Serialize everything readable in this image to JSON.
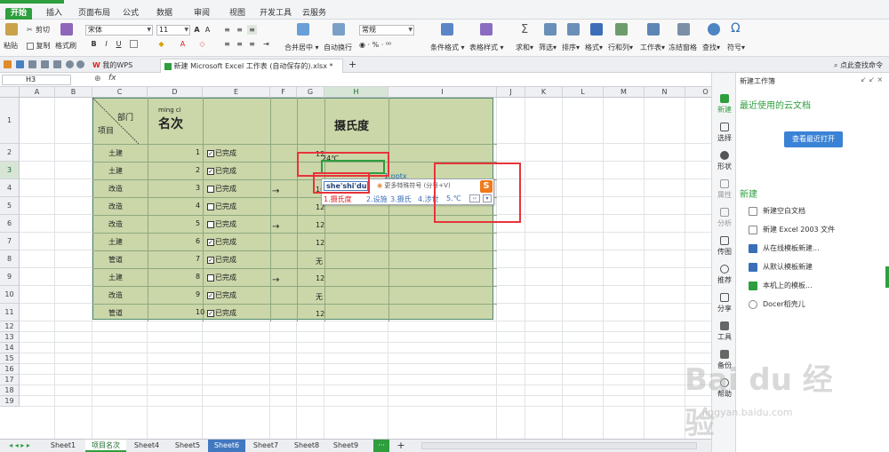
{
  "menu": {
    "tabs": [
      "开始",
      "插入",
      "页面布局",
      "公式",
      "数据",
      "审阅",
      "视图",
      "开发工具",
      "云服务"
    ],
    "active": "开始"
  },
  "ribbon": {
    "paste": "粘贴",
    "cut": "剪切",
    "copy": "复制",
    "format_painter": "格式刷",
    "font_name": "宋体",
    "font_size": "11",
    "merge_center": "合并居中",
    "wrap": "自动换行",
    "number_format": "常规",
    "cond_format": "条件格式",
    "table_style": "表格样式",
    "sum": "求和",
    "filter": "筛选",
    "sort": "排序",
    "format": "格式",
    "rows_cols": "行和列",
    "worksheet": "工作表",
    "freeze": "冻结窗格",
    "find": "查找",
    "symbol": "符号"
  },
  "docbar": {
    "tab1": "我的WPS",
    "tab2": "新建 Microsoft Excel 工作表 (自动保存的).xlsx *",
    "add": "+",
    "right_text": "点此查找命令"
  },
  "formula": {
    "cell_ref": "H3",
    "fx": "fx"
  },
  "columns": [
    "A",
    "B",
    "C",
    "D",
    "E",
    "F",
    "G",
    "H",
    "I",
    "J",
    "K",
    "L",
    "M",
    "N",
    "O"
  ],
  "rows": [
    "1",
    "2",
    "3",
    "4",
    "5",
    "6",
    "7",
    "8",
    "9",
    "10",
    "11",
    "12",
    "13",
    "14",
    "15",
    "16",
    "17",
    "18",
    "19"
  ],
  "table": {
    "header_dept": "部门",
    "header_item": "项目",
    "header_pinyin": "ming ci",
    "header_rank": "名次",
    "header_temp": "摄氏度",
    "depts": [
      "土建",
      "土建",
      "改造",
      "改造",
      "改造",
      "土建",
      "管道",
      "土建",
      "改造",
      "管道"
    ],
    "ranks": [
      "1",
      "2",
      "3",
      "4",
      "5",
      "6",
      "7",
      "8",
      "9",
      "10"
    ],
    "done_label": "已完成",
    "checked": [
      true,
      true,
      false,
      false,
      false,
      true,
      true,
      false,
      true,
      true
    ],
    "arrow": "→",
    "g_values": [
      "12",
      "",
      "10",
      "12",
      "12",
      "12",
      "无",
      "12",
      "无",
      "12"
    ],
    "h2_value": "24℃",
    "h3_link": "1.pptx"
  },
  "ime": {
    "input": "she'shi'du",
    "more": "更多特殊符号 (分号+V)",
    "candidates": [
      "1.摄氏度",
      "2.设施",
      "3.摄氏",
      "4.涉世",
      "5.℃"
    ]
  },
  "sheet_tabs": [
    "Sheet1",
    "项目名次",
    "Sheet4",
    "Sheet5",
    "Sheet6",
    "Sheet7",
    "Sheet8",
    "Sheet9"
  ],
  "sheet_tab_active": "项目名次",
  "sheet_tab_highlight": "Sheet6",
  "rail": [
    "新建",
    "选择",
    "形状",
    "属性",
    "分析",
    "传图",
    "推荐",
    "分享",
    "工具",
    "备份",
    "帮助"
  ],
  "panel": {
    "title": "新建工作簿",
    "recent": "最近使用的云文档",
    "open_btn": "查看最近打开",
    "new_heading": "新建",
    "links": [
      "新建空白文档",
      "新建 Excel 2003 文件",
      "从在线模板新建...",
      "从默认模板新建",
      "本机上的模板...",
      "Docer稻壳儿"
    ]
  },
  "watermark": {
    "brand": "Bai du 经验",
    "url": "jingyan.baidu.com"
  },
  "colors": {
    "accent": "#2e9e3e",
    "table_fill": "#cbd7a9",
    "red_box": "#e8333a",
    "link_blue": "#1e6ab8"
  }
}
